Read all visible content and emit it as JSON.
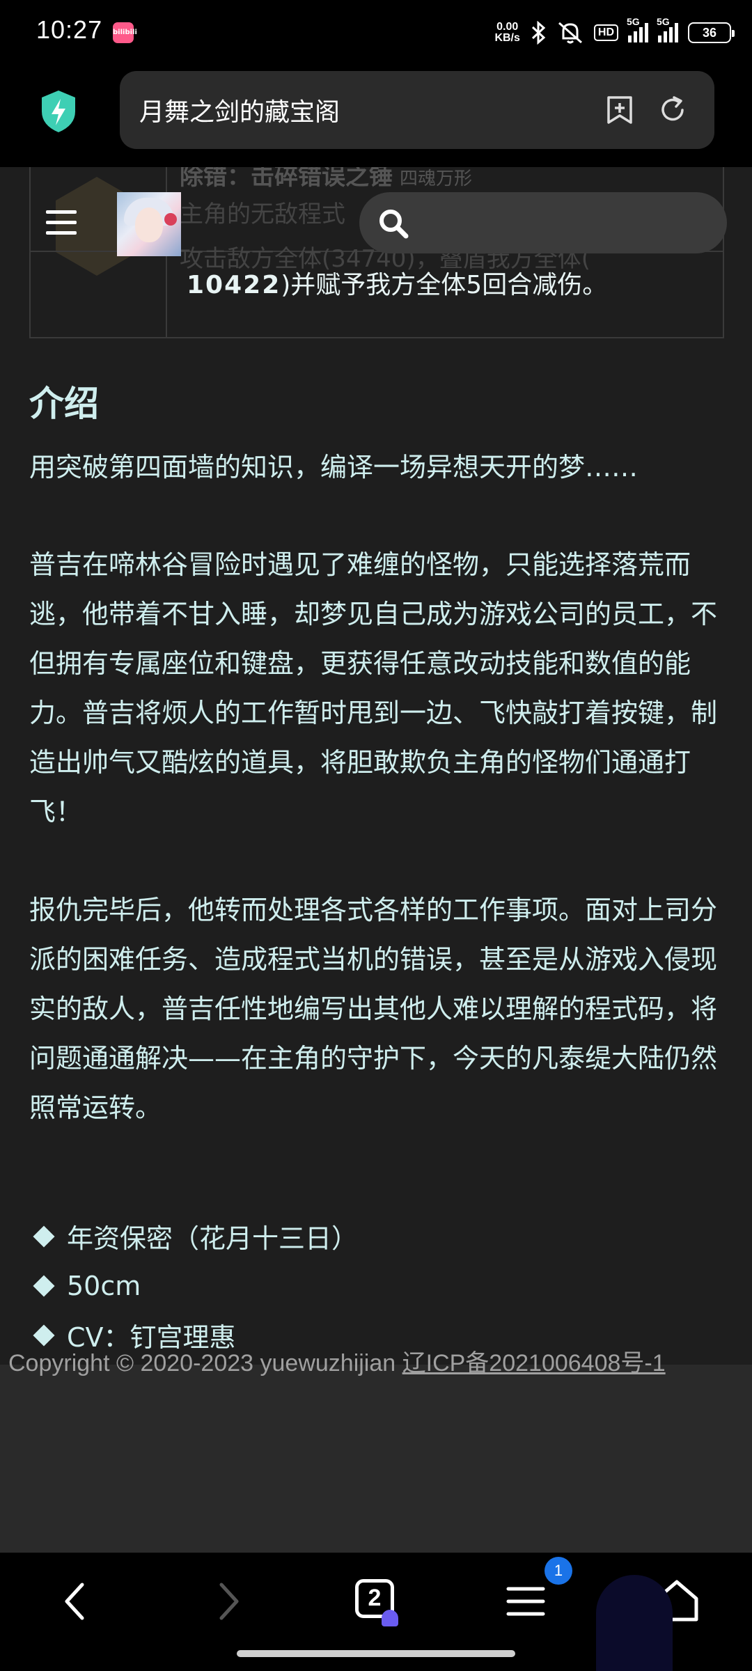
{
  "status_bar": {
    "time": "10:27",
    "app_icon_label": "bilibili",
    "net_speed_value": "0.00",
    "net_speed_unit": "KB/s",
    "hd_label": "HD",
    "sim1_label": "5G",
    "sim2_label": "5G",
    "battery": "36"
  },
  "browser": {
    "url_title": "月舞之剑的藏宝阁",
    "icons": {
      "shield": "shield-lightning-icon",
      "bookmark": "bookmark-add-icon",
      "refresh": "refresh-icon"
    }
  },
  "site_header": {
    "menu_icon": "hamburger-menu-icon",
    "avatar": "character-avatar",
    "search_placeholder": ""
  },
  "skill": {
    "name": "除错：击碎错误之锤",
    "name_suffix": "四魂万形",
    "faded_line1": "主角的无敌程式",
    "faded_line2": "攻击敌方全体(34740)，叠盾我方全体(",
    "number": "10422",
    "text_after": ")并赋予我方全体5回合减伤。"
  },
  "intro": {
    "title": "介绍",
    "tagline": "用突破第四面墙的知识，编译一场异想天开的梦……",
    "paragraph1": "普吉在啼林谷冒险时遇见了难缠的怪物，只能选择落荒而逃，他带着不甘入睡，却梦见自己成为游戏公司的员工，不但拥有专属座位和键盘，更获得任意改动技能和数值的能力。普吉将烦人的工作暂时甩到一边、飞快敲打着按键，制造出帅气又酷炫的道具，将胆敢欺负主角的怪物们通通打飞！",
    "paragraph2": "报仇完毕后，他转而处理各式各样的工作事项。面对上司分派的困难任务、造成程式当机的错误，甚至是从游戏入侵现实的敌人，普吉任性地编写出其他人难以理解的程式码，将问题通通解决——在主角的守护下，今天的凡泰缇大陆仍然照常运转。"
  },
  "facts": [
    "年资保密（花月十三日）",
    "50cm",
    "CV：钉宫理惠"
  ],
  "footer": {
    "copyright": "Copyright © 2020-2023 yuewuzhijian ",
    "icp": "辽ICP备2021006408号-1"
  },
  "bottom_nav": {
    "tabs_count": "2",
    "menu_badge": "1"
  },
  "colors": {
    "text": "#cfeeee",
    "page_bg": "#1e1e1e",
    "footer_bg": "#2a2a2a",
    "badge": "#1a73e8"
  }
}
